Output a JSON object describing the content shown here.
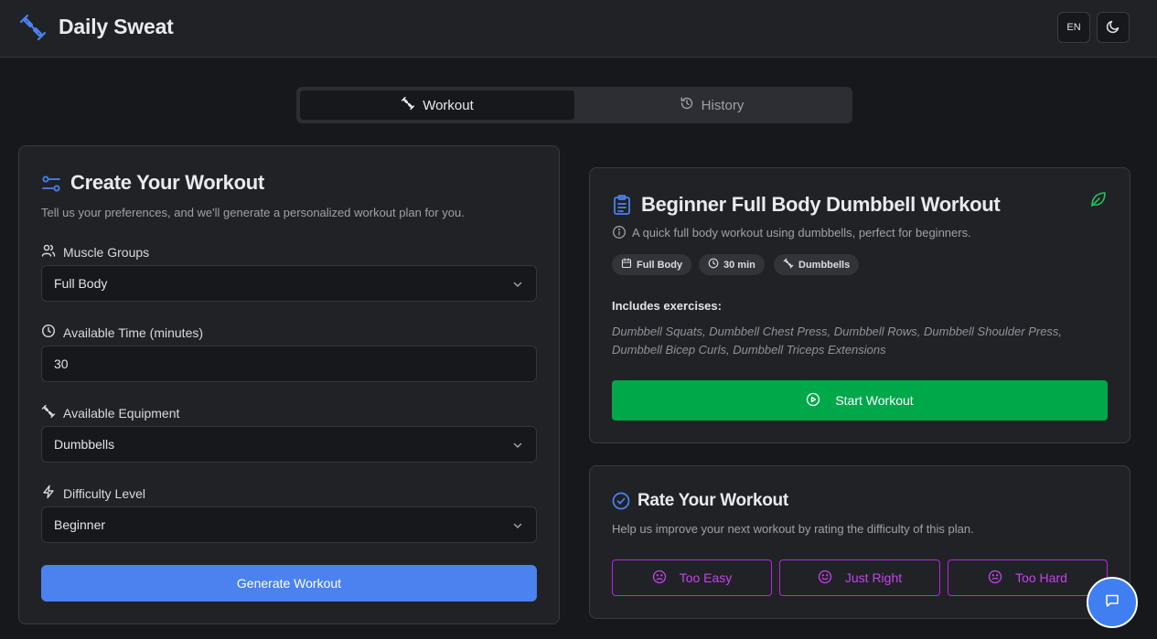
{
  "header": {
    "app_title": "Daily Sweat",
    "lang_label": "EN",
    "icons": {
      "logo": "dumbbell-icon",
      "theme": "moon-icon"
    }
  },
  "tabs": [
    {
      "label": "Workout",
      "icon": "dumbbell-icon",
      "active": true
    },
    {
      "label": "History",
      "icon": "history-icon",
      "active": false
    }
  ],
  "create": {
    "title": "Create Your Workout",
    "description": "Tell us your preferences, and we'll generate a personalized workout plan for you.",
    "fields": {
      "muscle_groups": {
        "label": "Muscle Groups",
        "value": "Full Body"
      },
      "available_time": {
        "label": "Available Time (minutes)",
        "value": "30"
      },
      "equipment": {
        "label": "Available Equipment",
        "value": "Dumbbells"
      },
      "difficulty": {
        "label": "Difficulty Level",
        "value": "Beginner"
      }
    },
    "generate_label": "Generate Workout"
  },
  "plan": {
    "title": "Beginner Full Body Dumbbell Workout",
    "description": "A quick full body workout using dumbbells, perfect for beginners.",
    "badges": [
      {
        "label": "Full Body",
        "icon": "calendar-icon"
      },
      {
        "label": "30 min",
        "icon": "clock-icon"
      },
      {
        "label": "Dumbbells",
        "icon": "dumbbell-icon"
      }
    ],
    "includes_label": "Includes exercises:",
    "exercises": "Dumbbell Squats, Dumbbell Chest Press, Dumbbell Rows, Dumbbell Shoulder Press, Dumbbell Bicep Curls, Dumbbell Triceps Extensions",
    "start_label": "Start Workout"
  },
  "rate": {
    "title": "Rate Your Workout",
    "description": "Help us improve your next workout by rating the difficulty of this plan.",
    "options": [
      "Too Easy",
      "Just Right",
      "Too Hard"
    ]
  },
  "colors": {
    "accent_blue": "#4b82f0",
    "success_green": "#00a84a",
    "rating_purple": "#b526e8",
    "leaf_green": "#22c55e"
  }
}
